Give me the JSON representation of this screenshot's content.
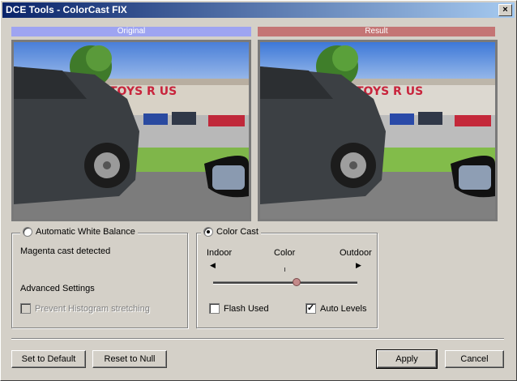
{
  "window": {
    "title": "DCE Tools - ColorCast FIX",
    "close_glyph": "×"
  },
  "panels": {
    "original_label": "Original",
    "result_label": "Result",
    "original_image": "parking-lot-truck-photo",
    "result_image": "parking-lot-truck-photo-corrected"
  },
  "awb": {
    "label": "Automatic White Balance",
    "selected": false,
    "status": "Magenta cast detected",
    "advanced_label": "Advanced Settings",
    "prevent_label": "Prevent Histogram stretching",
    "prevent_checked": false,
    "prevent_enabled": false
  },
  "colorcast": {
    "label": "Color Cast",
    "selected": true,
    "indoor_label": "Indoor",
    "color_label": "Color",
    "outdoor_label": "Outdoor",
    "slider_value": 0.58,
    "flash_label": "Flash Used",
    "flash_checked": false,
    "auto_levels_label": "Auto Levels",
    "auto_levels_checked": true
  },
  "buttons": {
    "set_default": "Set to Default",
    "reset_null": "Reset to Null",
    "apply": "Apply",
    "cancel": "Cancel"
  },
  "colors": {
    "original_header": "#9ea4f1",
    "result_header": "#c47575",
    "dialog_bg": "#d4d0c8"
  }
}
